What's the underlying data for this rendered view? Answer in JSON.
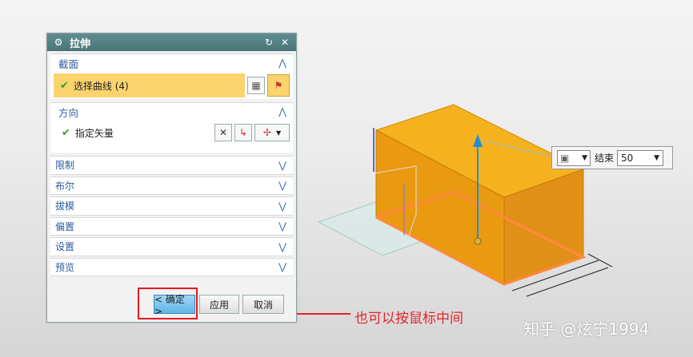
{
  "dialog": {
    "title": "拉伸",
    "section_jiemian": {
      "label": "截面",
      "select_curve": "选择曲线 (4)"
    },
    "section_fangxiang": {
      "label": "方向",
      "specify_vector": "指定矢量"
    },
    "collapsed_sections": [
      "限制",
      "布尔",
      "拔模",
      "偏置",
      "设置",
      "预览"
    ],
    "buttons": {
      "ok": "< 确定 >",
      "apply": "应用",
      "cancel": "取消"
    }
  },
  "floating_input": {
    "end_label": "结束",
    "end_value": "50"
  },
  "annotation": "也可以按鼠标中间",
  "watermark": "知乎 @炫宁1994",
  "colors": {
    "title_bar": "#4f7c7e",
    "highlight": "#fbd46e",
    "box_orange": "#e99a10",
    "box_top": "#f6b21e",
    "annotation_red": "#e5232a",
    "section_blue": "#2b5b9c"
  }
}
